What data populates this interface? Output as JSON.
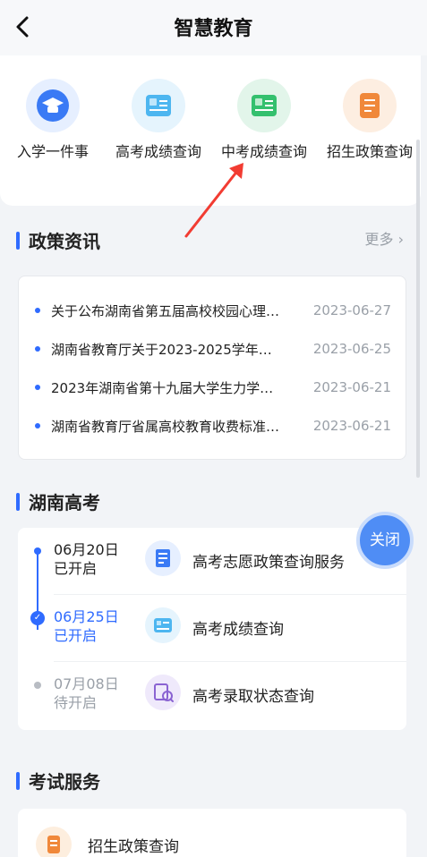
{
  "header": {
    "title": "智慧教育"
  },
  "grid": [
    {
      "label": "入学一件事",
      "icon": "graduation-cap-icon",
      "color": "#3a7af5",
      "bg": "#e6efff"
    },
    {
      "label": "高考成绩查询",
      "icon": "gaokao-card-icon",
      "color": "#4db6f0",
      "bg": "#e5f4fd"
    },
    {
      "label": "中考成绩查询",
      "icon": "zhongkao-card-icon",
      "color": "#34c06e",
      "bg": "#e2f5ea"
    },
    {
      "label": "招生政策查询",
      "icon": "document-icon",
      "color": "#f0883a",
      "bg": "#fdeee1"
    }
  ],
  "policy": {
    "title": "政策资讯",
    "more": "更多",
    "items": [
      {
        "text": "关于公布湖南省第五届高校校园心理…",
        "date": "2023-06-27"
      },
      {
        "text": "湖南省教育厅关于2023-2025学年…",
        "date": "2023-06-25"
      },
      {
        "text": "2023年湖南省第十九届大学生力学…",
        "date": "2023-06-21"
      },
      {
        "text": "湖南省教育厅省属高校教育收费标准…",
        "date": "2023-06-21"
      }
    ]
  },
  "gaokao": {
    "title": "湖南高考",
    "rows": [
      {
        "date": "06月20日",
        "status": "已开启",
        "label": "高考志愿政策查询服务",
        "icon": "notebook-icon"
      },
      {
        "date": "06月25日",
        "status": "已开启",
        "label": "高考成绩查询",
        "icon": "gaokao-card-icon"
      },
      {
        "date": "07月08日",
        "status": "待开启",
        "label": "高考录取状态查询",
        "icon": "search-person-icon"
      }
    ]
  },
  "close_button": "关闭",
  "exam": {
    "title": "考试服务",
    "items": [
      {
        "label": "招生政策查询",
        "icon": "document-icon"
      }
    ]
  },
  "colors": {
    "accent": "#2f6bff",
    "muted": "#9aa0a8"
  }
}
